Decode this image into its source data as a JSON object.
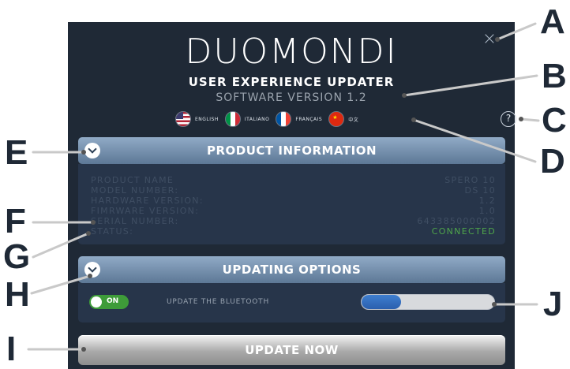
{
  "app": {
    "brand": "DUOMONDI",
    "subtitle": "USER EXPERIENCE UPDATER",
    "version": "SOFTWARE VERSION 1.2"
  },
  "languages": [
    {
      "label": "ENGLISH",
      "flag": "us-flag-icon"
    },
    {
      "label": "ITALIANO",
      "flag": "italy-flag-icon"
    },
    {
      "label": "FRANÇAIS",
      "flag": "france-flag-icon"
    },
    {
      "label": "中文",
      "flag": "china-flag-icon"
    }
  ],
  "help_label": "?",
  "close_label": "×",
  "product_info": {
    "title": "PRODUCT INFORMATION",
    "rows": [
      {
        "key": "PRODUCT NAME",
        "value": "SPERO 10"
      },
      {
        "key": "MODEL NUMBER:",
        "value": "DS 10"
      },
      {
        "key": "HARDWARE VERSION:",
        "value": "1.2"
      },
      {
        "key": "FIMRWARE VERSION:",
        "value": "1.0"
      },
      {
        "key": "SERIAL NUMBER:",
        "value": "643385000002"
      },
      {
        "key": "STATUS:",
        "value": "CONNECTED"
      }
    ]
  },
  "updating_options": {
    "title": "UPDATING OPTIONS",
    "toggle_label": "ON",
    "option_label": "UPDATE THE BLUETOOTH",
    "progress": 0.3
  },
  "update_button": "UPDATE NOW",
  "callouts": [
    "A",
    "B",
    "C",
    "D",
    "E",
    "F",
    "G",
    "H",
    "I",
    "J"
  ],
  "colors": {
    "panel": "#1f2936",
    "accent_green": "#4fa54a",
    "progress_blue": "#3f7fd0"
  }
}
